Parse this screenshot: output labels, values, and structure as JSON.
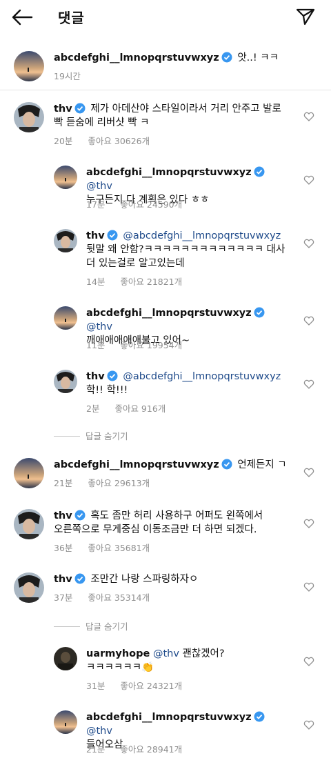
{
  "header": {
    "title": "댓글"
  },
  "caption": {
    "username": "abcdefghi__lmnopqrstuvwxyz",
    "text": "앗..! ㅋㅋ",
    "time": "19시간"
  },
  "comments": [
    {
      "username": "thv",
      "mention": "",
      "text": "제가 아데산야 스타일이라서 거리 안주고 발로",
      "text2": "빡 듣숨에 리버샷 빡 ㅋ",
      "time": "20분",
      "likes": "좋아요 30626개"
    },
    {
      "username": "abcdefghi__lmnopqrstuvwxyz",
      "mention": "@thv",
      "text": "누구든지 다 계획은 있다 ㅎㅎ",
      "time": "17분",
      "likes": "좋아요 24590개"
    },
    {
      "username": "thv",
      "mention": "@abcdefghi__lmnopqrstuvwxyz",
      "text": "뒷말 왜 안함?ㅋㅋㅋㅋㅋㅋㅋㅋㅋㅋㅋㅋㅋ 대사",
      "text2": "더 있는걸로 알고있는데",
      "time": "14분",
      "likes": "좋아요 21821개"
    },
    {
      "username": "abcdefghi__lmnopqrstuvwxyz",
      "mention": "@thv",
      "text": "깨애애애애애불고 있어~",
      "time": "11분",
      "likes": "좋아요 19954개"
    },
    {
      "username": "thv",
      "mention": "@abcdefghi__lmnopqrstuvwxyz",
      "text": "학!! 학!!!",
      "time": "2분",
      "likes": "좋아요 916개"
    },
    {
      "username": "abcdefghi__lmnopqrstuvwxyz",
      "mention": "",
      "text": "언제든지 ㄱ",
      "time": "21분",
      "likes": "좋아요 29613개"
    },
    {
      "username": "thv",
      "mention": "",
      "text": "혹도 좀만 허리 사용하구 어퍼도 왼쪽에서",
      "text2": "오른쪽으로 무게중심 이동조금만 더 하면 되겠다.",
      "time": "36분",
      "likes": "좋아요 35681개"
    },
    {
      "username": "thv",
      "mention": "",
      "text": "조만간 나랑 스파링하자ㅇ",
      "time": "37분",
      "likes": "좋아요 35314개"
    },
    {
      "username": "uarmyhope",
      "mention": "@thv",
      "text": "괜찮겠어?",
      "text2": "ㅋㅋㅋㅋㅋㅋ👏",
      "time": "31분",
      "likes": "좋아요 24321개"
    },
    {
      "username": "abcdefghi__lmnopqrstuvwxyz",
      "mention": "@thv",
      "text": "들어오삼",
      "time": "21분",
      "likes": "좋아요 28941개"
    }
  ],
  "replies_toggle": {
    "label": "답글 숨기기"
  },
  "colors": {
    "verified": "#3897f0",
    "mention": "#1e4a8a",
    "meta": "#8e8e8e"
  }
}
